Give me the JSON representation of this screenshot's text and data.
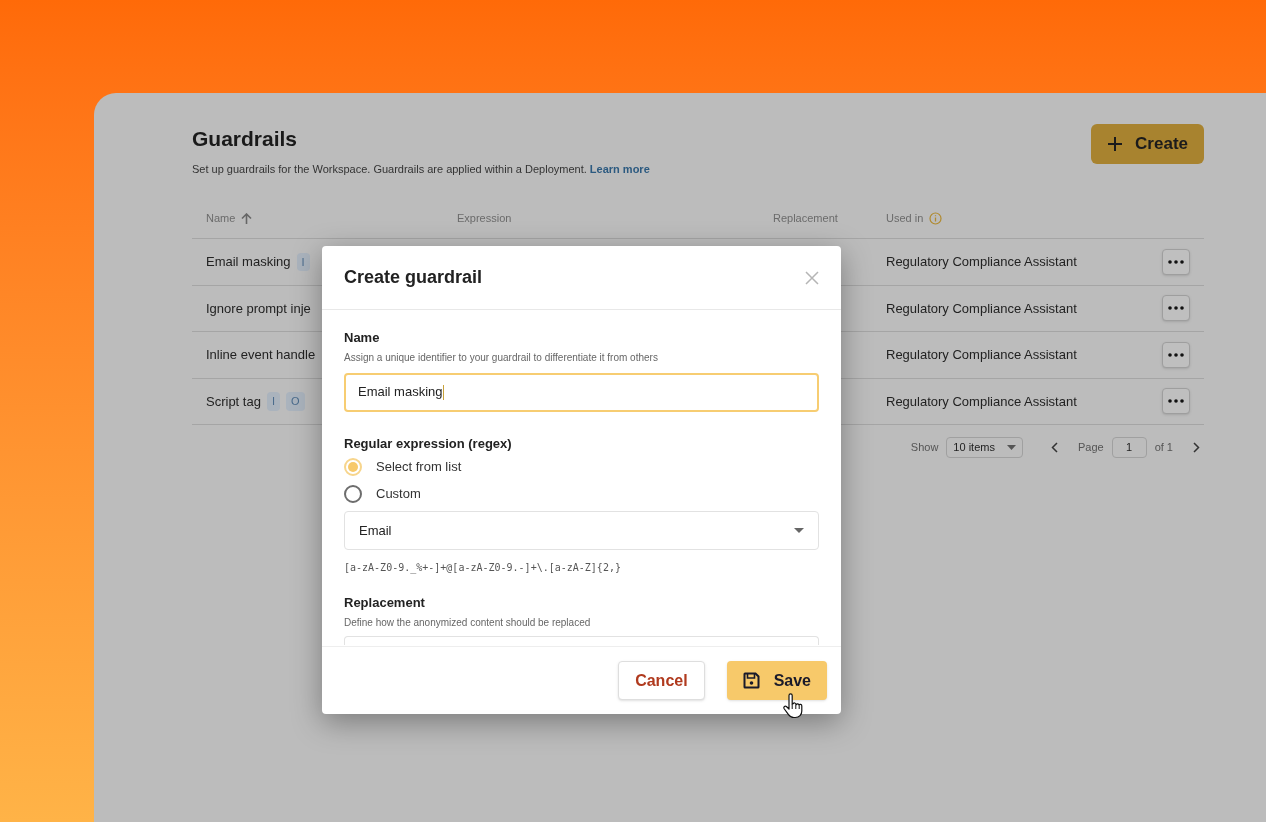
{
  "page": {
    "title": "Guardrails",
    "subtitle": "Set up guardrails for the Workspace. Guardrails are applied within a Deployment.",
    "learn_more": "Learn more",
    "create_button": "Create"
  },
  "table": {
    "columns": [
      {
        "label": "Name",
        "sorted": true
      },
      {
        "label": "Expression"
      },
      {
        "label": "Replacement"
      },
      {
        "label": "Used in",
        "info": true
      }
    ],
    "rows": [
      {
        "name": "Email masking",
        "badges": [
          "I"
        ],
        "used_in": "Regulatory Compliance Assistant"
      },
      {
        "name": "Ignore prompt inje",
        "badges": [],
        "used_in": "Regulatory Compliance Assistant"
      },
      {
        "name": "Inline event handle",
        "badges": [],
        "used_in": "Regulatory Compliance Assistant"
      },
      {
        "name": "Script tag",
        "badges": [
          "I",
          "O"
        ],
        "used_in": "Regulatory Compliance Assistant"
      }
    ]
  },
  "pagination": {
    "show_label": "Show",
    "page_size": "10 items",
    "page_label": "Page",
    "page": "1",
    "of": "of 1"
  },
  "dialog": {
    "title": "Create guardrail",
    "name_field": {
      "label": "Name",
      "hint": "Assign a unique identifier to your guardrail to differentiate it from others",
      "value": "Email masking",
      "focused": true
    },
    "regex": {
      "label": "Regular expression (regex)",
      "options": [
        {
          "label": "Select from list",
          "selected": true
        },
        {
          "label": "Custom",
          "selected": false
        }
      ],
      "select_value": "Email",
      "expression": "[a-zA-Z0-9._%+-]+@[a-zA-Z0-9.-]+\\.[a-zA-Z]{2,}"
    },
    "replacement": {
      "label": "Replacement",
      "hint": "Define how the anonymized content should be replaced"
    },
    "buttons": [
      {
        "label": "Cancel",
        "kind": "secondary"
      },
      {
        "label": "Save",
        "kind": "primary"
      }
    ]
  }
}
